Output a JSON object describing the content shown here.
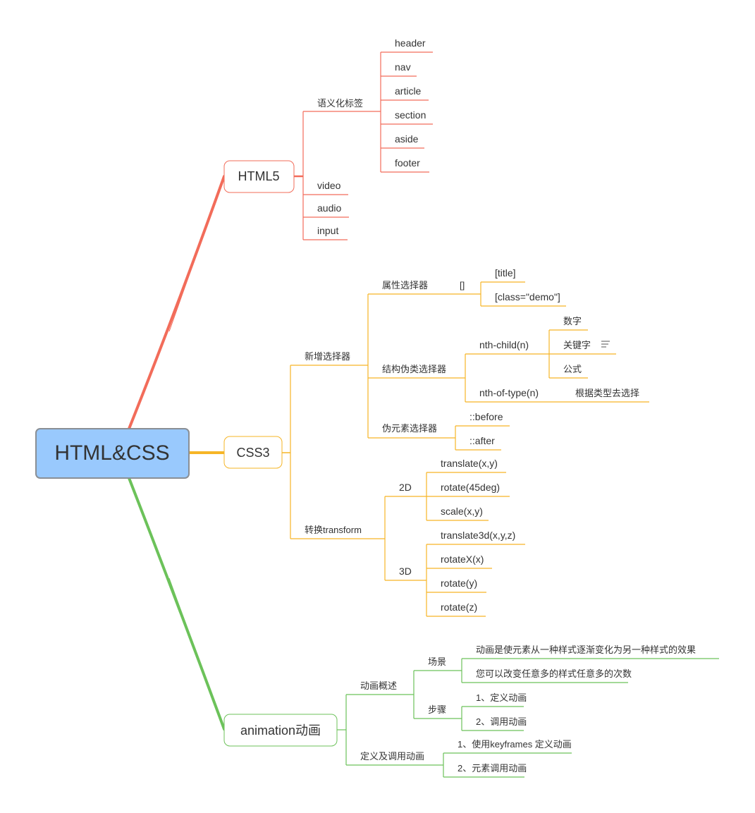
{
  "colors": {
    "root_fill": "#99c9fd",
    "root_border": "#8a8f95",
    "html5": "#f26c5a",
    "css3": "#f6b526",
    "animation": "#6cc25a",
    "text": "#333333"
  },
  "root": {
    "label": "HTML&CSS"
  },
  "html5": {
    "label": "HTML5",
    "semantic": {
      "label": "语义化标签",
      "items": [
        "header",
        "nav",
        "article",
        "section",
        "aside",
        "footer"
      ]
    },
    "media": [
      "video",
      "audio",
      "input"
    ]
  },
  "css3": {
    "label": "CSS3",
    "selectors": {
      "label": "新增选择器",
      "attr": {
        "label": "属性选择器",
        "note": "[]",
        "items": [
          "[title]",
          "[class=\"demo\"]"
        ]
      },
      "structural": {
        "label": "结构伪类选择器",
        "nth_child": {
          "label": "nth-child(n)",
          "items": [
            "数字",
            "关键字",
            "公式"
          ]
        },
        "nth_of_type": {
          "label": "nth-of-type(n)",
          "note": "根据类型去选择"
        }
      },
      "pseudo": {
        "label": "伪元素选择器",
        "items": [
          "::before",
          "::after"
        ]
      }
    },
    "transform": {
      "label": "转换transform",
      "d2": {
        "label": "2D",
        "items": [
          "translate(x,y)",
          "rotate(45deg)",
          "scale(x,y)"
        ]
      },
      "d3": {
        "label": "3D",
        "items": [
          "translate3d(x,y,z)",
          "rotateX(x)",
          "rotate(y)",
          "rotate(z)"
        ]
      }
    }
  },
  "animation": {
    "label": "animation动画",
    "overview": {
      "label": "动画概述",
      "scene": {
        "label": "场景",
        "items": [
          "动画是使元素从一种样式逐渐变化为另一种样式的效果",
          "您可以改变任意多的样式任意多的次数"
        ]
      },
      "steps": {
        "label": "步骤",
        "items": [
          "1、定义动画",
          "2、调用动画"
        ]
      }
    },
    "define": {
      "label": "定义及调用动画",
      "items": [
        "1、使用keyframes 定义动画",
        "2、元素调用动画"
      ]
    }
  }
}
